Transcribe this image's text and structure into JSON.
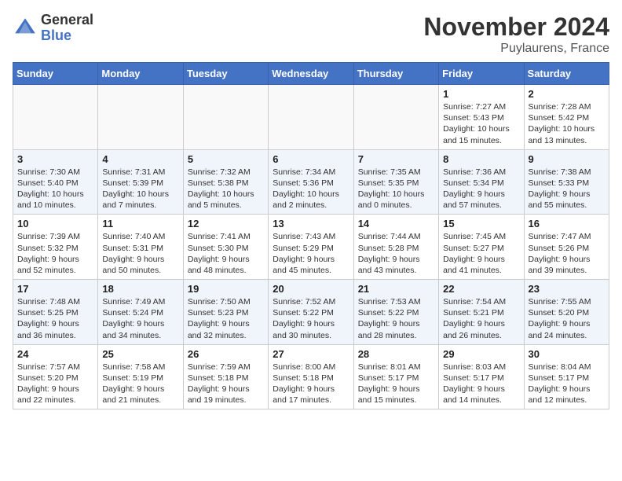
{
  "header": {
    "logo_general": "General",
    "logo_blue": "Blue",
    "month_title": "November 2024",
    "location": "Puylaurens, France"
  },
  "columns": [
    "Sunday",
    "Monday",
    "Tuesday",
    "Wednesday",
    "Thursday",
    "Friday",
    "Saturday"
  ],
  "weeks": [
    [
      {
        "day": "",
        "info": ""
      },
      {
        "day": "",
        "info": ""
      },
      {
        "day": "",
        "info": ""
      },
      {
        "day": "",
        "info": ""
      },
      {
        "day": "",
        "info": ""
      },
      {
        "day": "1",
        "info": "Sunrise: 7:27 AM\nSunset: 5:43 PM\nDaylight: 10 hours and 15 minutes."
      },
      {
        "day": "2",
        "info": "Sunrise: 7:28 AM\nSunset: 5:42 PM\nDaylight: 10 hours and 13 minutes."
      }
    ],
    [
      {
        "day": "3",
        "info": "Sunrise: 7:30 AM\nSunset: 5:40 PM\nDaylight: 10 hours and 10 minutes."
      },
      {
        "day": "4",
        "info": "Sunrise: 7:31 AM\nSunset: 5:39 PM\nDaylight: 10 hours and 7 minutes."
      },
      {
        "day": "5",
        "info": "Sunrise: 7:32 AM\nSunset: 5:38 PM\nDaylight: 10 hours and 5 minutes."
      },
      {
        "day": "6",
        "info": "Sunrise: 7:34 AM\nSunset: 5:36 PM\nDaylight: 10 hours and 2 minutes."
      },
      {
        "day": "7",
        "info": "Sunrise: 7:35 AM\nSunset: 5:35 PM\nDaylight: 10 hours and 0 minutes."
      },
      {
        "day": "8",
        "info": "Sunrise: 7:36 AM\nSunset: 5:34 PM\nDaylight: 9 hours and 57 minutes."
      },
      {
        "day": "9",
        "info": "Sunrise: 7:38 AM\nSunset: 5:33 PM\nDaylight: 9 hours and 55 minutes."
      }
    ],
    [
      {
        "day": "10",
        "info": "Sunrise: 7:39 AM\nSunset: 5:32 PM\nDaylight: 9 hours and 52 minutes."
      },
      {
        "day": "11",
        "info": "Sunrise: 7:40 AM\nSunset: 5:31 PM\nDaylight: 9 hours and 50 minutes."
      },
      {
        "day": "12",
        "info": "Sunrise: 7:41 AM\nSunset: 5:30 PM\nDaylight: 9 hours and 48 minutes."
      },
      {
        "day": "13",
        "info": "Sunrise: 7:43 AM\nSunset: 5:29 PM\nDaylight: 9 hours and 45 minutes."
      },
      {
        "day": "14",
        "info": "Sunrise: 7:44 AM\nSunset: 5:28 PM\nDaylight: 9 hours and 43 minutes."
      },
      {
        "day": "15",
        "info": "Sunrise: 7:45 AM\nSunset: 5:27 PM\nDaylight: 9 hours and 41 minutes."
      },
      {
        "day": "16",
        "info": "Sunrise: 7:47 AM\nSunset: 5:26 PM\nDaylight: 9 hours and 39 minutes."
      }
    ],
    [
      {
        "day": "17",
        "info": "Sunrise: 7:48 AM\nSunset: 5:25 PM\nDaylight: 9 hours and 36 minutes."
      },
      {
        "day": "18",
        "info": "Sunrise: 7:49 AM\nSunset: 5:24 PM\nDaylight: 9 hours and 34 minutes."
      },
      {
        "day": "19",
        "info": "Sunrise: 7:50 AM\nSunset: 5:23 PM\nDaylight: 9 hours and 32 minutes."
      },
      {
        "day": "20",
        "info": "Sunrise: 7:52 AM\nSunset: 5:22 PM\nDaylight: 9 hours and 30 minutes."
      },
      {
        "day": "21",
        "info": "Sunrise: 7:53 AM\nSunset: 5:22 PM\nDaylight: 9 hours and 28 minutes."
      },
      {
        "day": "22",
        "info": "Sunrise: 7:54 AM\nSunset: 5:21 PM\nDaylight: 9 hours and 26 minutes."
      },
      {
        "day": "23",
        "info": "Sunrise: 7:55 AM\nSunset: 5:20 PM\nDaylight: 9 hours and 24 minutes."
      }
    ],
    [
      {
        "day": "24",
        "info": "Sunrise: 7:57 AM\nSunset: 5:20 PM\nDaylight: 9 hours and 22 minutes."
      },
      {
        "day": "25",
        "info": "Sunrise: 7:58 AM\nSunset: 5:19 PM\nDaylight: 9 hours and 21 minutes."
      },
      {
        "day": "26",
        "info": "Sunrise: 7:59 AM\nSunset: 5:18 PM\nDaylight: 9 hours and 19 minutes."
      },
      {
        "day": "27",
        "info": "Sunrise: 8:00 AM\nSunset: 5:18 PM\nDaylight: 9 hours and 17 minutes."
      },
      {
        "day": "28",
        "info": "Sunrise: 8:01 AM\nSunset: 5:17 PM\nDaylight: 9 hours and 15 minutes."
      },
      {
        "day": "29",
        "info": "Sunrise: 8:03 AM\nSunset: 5:17 PM\nDaylight: 9 hours and 14 minutes."
      },
      {
        "day": "30",
        "info": "Sunrise: 8:04 AM\nSunset: 5:17 PM\nDaylight: 9 hours and 12 minutes."
      }
    ]
  ]
}
